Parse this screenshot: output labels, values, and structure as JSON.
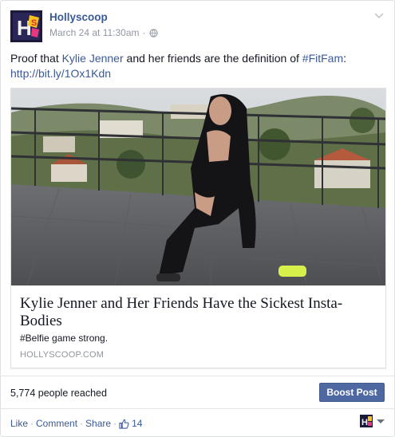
{
  "post": {
    "page_name": "Hollyscoop",
    "timestamp": "March 24 at 11:30am",
    "separator": "·",
    "text_before": "Proof that ",
    "mention": "Kylie Jenner",
    "text_middle": " and her friends are the definition of ",
    "hashtag": "#FitFam",
    "text_after": ":",
    "link": "http://bit.ly/1Ox1Kdn"
  },
  "attachment": {
    "title": "Kylie Jenner and Her Friends Have the Sickest Insta-Bodies",
    "description": "#Belfie game strong.",
    "domain": "HOLLYSCOOP.COM"
  },
  "stats": {
    "reach": "5,774 people reached",
    "boost_label": "Boost Post"
  },
  "actions": {
    "like": "Like",
    "comment": "Comment",
    "share": "Share",
    "dot": "·",
    "like_count": "14"
  },
  "icons": {
    "avatar": "hollyscoop-logo-icon",
    "privacy": "globe-icon",
    "menu": "chevron-down-icon",
    "like": "thumbs-up-icon"
  },
  "colors": {
    "link": "#3b5998",
    "boost_bg": "#4e69a2",
    "meta": "#9197a3"
  }
}
